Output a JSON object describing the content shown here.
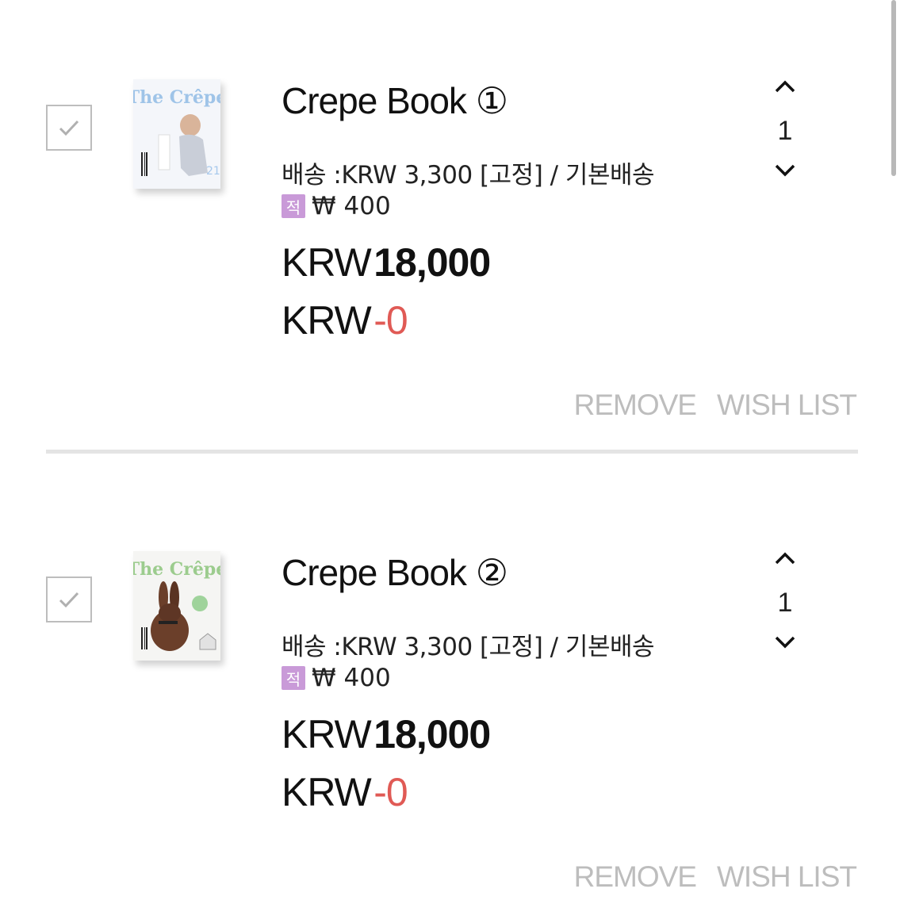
{
  "cart": {
    "items": [
      {
        "title": "Crepe Book ①",
        "shipping": "배송 :KRW 3,300 [고정] / 기본배송",
        "points_badge": "적",
        "points": "₩ 400",
        "currency": "KRW",
        "price": "18,000",
        "discount_currency": "KRW",
        "discount": "-0",
        "quantity": "1",
        "remove_label": "REMOVE",
        "wishlist_label": "WISH LIST",
        "cover_title": "The Crêpe",
        "checked": true
      },
      {
        "title": "Crepe Book ②",
        "shipping": "배송 :KRW 3,300 [고정] / 기본배송",
        "points_badge": "적",
        "points": "₩ 400",
        "currency": "KRW",
        "price": "18,000",
        "discount_currency": "KRW",
        "discount": "-0",
        "quantity": "1",
        "remove_label": "REMOVE",
        "wishlist_label": "WISH LIST",
        "cover_title": "The Crêpe",
        "checked": true
      }
    ]
  },
  "colors": {
    "discount_red": "#e05a55",
    "action_gray": "#bdbdbd",
    "points_badge": "#c99ad8"
  },
  "icons": {
    "checkbox": "checkmark-icon",
    "qty_up": "chevron-up-icon",
    "qty_down": "chevron-down-icon"
  }
}
